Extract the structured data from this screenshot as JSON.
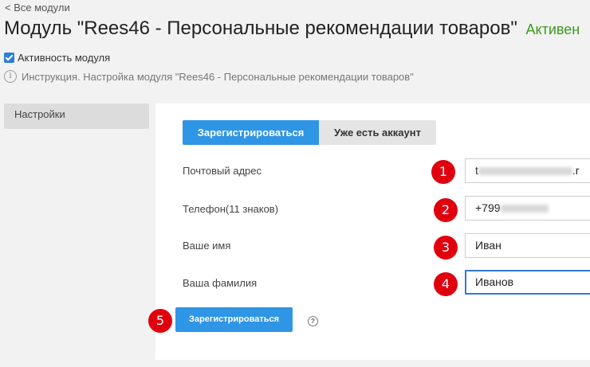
{
  "back_link": "< Все модули",
  "title": "Модуль \"Rees46 - Персональные рекомендации товаров\"",
  "status": "Активен",
  "activity_label": "Активность модуля",
  "instruction_text": "Инструкция. Настройка модуля \"Rees46 - Персональные рекомендации товаров\"",
  "sidebar_tab": "Настройки",
  "tabs": {
    "register": "Зарегистрироваться",
    "have_account": "Уже есть аккаунт"
  },
  "fields": {
    "email": {
      "label": "Почтовый адрес",
      "value_prefix": "t",
      "value_suffix": ".r"
    },
    "phone": {
      "label": "Телефон(11 знаков)",
      "value_prefix": "+799"
    },
    "first_name": {
      "label": "Ваше имя",
      "value": "Иван"
    },
    "last_name": {
      "label": "Ваша фамилия",
      "value": "Иванов"
    }
  },
  "badges": [
    "1",
    "2",
    "3",
    "4",
    "5"
  ],
  "submit_label": "Зарегистрироваться",
  "help_glyph": "?",
  "info_glyph": "i",
  "colors": {
    "accent": "#2f95e5",
    "status": "#3c9a1e",
    "badge": "#e0000d"
  }
}
